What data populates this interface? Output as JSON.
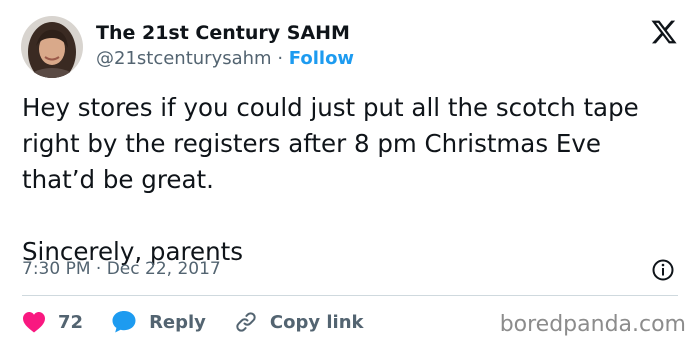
{
  "author": {
    "display_name": "The 21st Century SAHM",
    "handle": "@21stcenturysahm",
    "separator": "·",
    "follow_label": "Follow"
  },
  "tweet": {
    "lines": [
      "Hey stores if you could just put all the scotch tape",
      "right by the registers after 8 pm Christmas Eve",
      "that’d be great."
    ],
    "signoff": "Sincerely, parents",
    "timestamp": "7:30 PM · Dec 22, 2017"
  },
  "actions": {
    "like_count": "72",
    "reply_label": "Reply",
    "copy_link_label": "Copy link"
  },
  "watermark": "boredpanda.com",
  "icons": {
    "logo": "x-logo-icon",
    "info": "info-icon",
    "like": "heart-icon",
    "reply": "speech-bubble-icon",
    "copy": "link-icon"
  },
  "colors": {
    "text": "#0f1419",
    "secondary": "#536471",
    "follow": "#1d9bf0",
    "heart": "#f91880",
    "reply": "#1d9bf0",
    "divider": "#cfd9de"
  }
}
